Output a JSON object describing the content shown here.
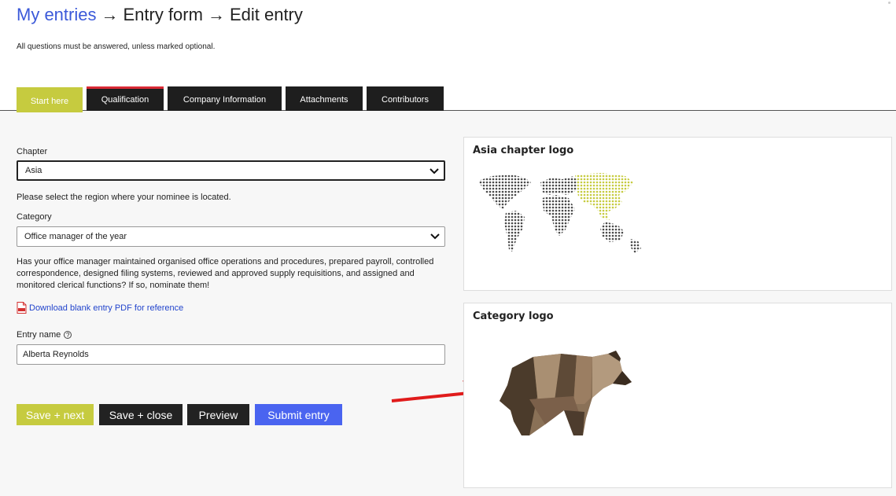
{
  "breadcrumb": {
    "my_entries": "My entries",
    "entry_form": "Entry form",
    "edit_entry": "Edit entry",
    "separator": "→"
  },
  "intro": "All questions must be answered, unless marked optional.",
  "tabs": [
    {
      "label": "Start here",
      "state": "active"
    },
    {
      "label": "Qualification",
      "state": "error"
    },
    {
      "label": "Company Information",
      "state": "normal"
    },
    {
      "label": "Attachments",
      "state": "normal"
    },
    {
      "label": "Contributors",
      "state": "normal"
    }
  ],
  "form": {
    "chapter_label": "Chapter",
    "chapter_value": "Asia",
    "chapter_help": "Please select the region where your nominee is located.",
    "category_label": "Category",
    "category_value": "Office manager of the year",
    "category_help": "Has your office manager maintained organised office operations and procedures, prepared payroll, controlled correspondence, designed filing systems, reviewed and approved supply requisitions, and assigned and monitored clerical functions? If so, nominate them!",
    "download_link": "Download blank entry PDF for reference",
    "entry_name_label": "Entry name",
    "entry_name_value": "Alberta Reynolds"
  },
  "buttons": {
    "save_next": "Save + next",
    "save_close": "Save + close",
    "preview": "Preview",
    "submit": "Submit entry"
  },
  "panels": {
    "chapter_logo_title": "Asia chapter logo",
    "category_logo_title": "Category logo"
  },
  "colors": {
    "accent_green": "#c6cb3f",
    "primary_blue": "#4a64f0",
    "dark": "#222222",
    "error_red": "#d92a35",
    "link_blue": "#3b59d9"
  },
  "icons": [
    "chevron-down-icon",
    "pdf-file-icon",
    "question-circle-icon",
    "world-map-logo",
    "bear-logo",
    "red-arrow-annotation"
  ]
}
